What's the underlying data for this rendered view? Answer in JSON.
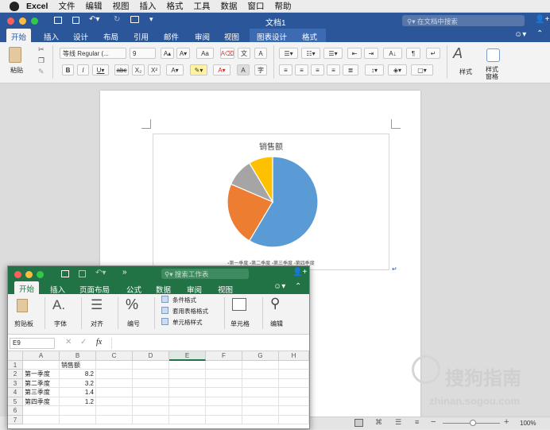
{
  "menubar": {
    "app": "Excel",
    "items": [
      "文件",
      "编辑",
      "视图",
      "插入",
      "格式",
      "工具",
      "数据",
      "窗口",
      "帮助"
    ]
  },
  "word": {
    "title": "文档1",
    "search_placeholder": "在文档中搜索",
    "tabs": [
      "开始",
      "插入",
      "设计",
      "布局",
      "引用",
      "邮件",
      "审阅",
      "视图",
      "图表设计",
      "格式"
    ],
    "font_name": "等线 Regular (...",
    "font_size": "9",
    "paste_label": "粘贴",
    "styles_label": "样式",
    "styles_pane_label": "样式\n窗格",
    "zoom": "100%"
  },
  "chart": {
    "title": "销售额",
    "legend": [
      "第一季度",
      "第二季度",
      "第三季度",
      "第四季度"
    ]
  },
  "chart_data": {
    "type": "pie",
    "title": "销售额",
    "categories": [
      "第一季度",
      "第二季度",
      "第三季度",
      "第四季度"
    ],
    "values": [
      8.2,
      3.2,
      1.4,
      1.2
    ],
    "colors": [
      "#5b9bd5",
      "#ed7d31",
      "#a5a5a5",
      "#ffc000"
    ],
    "legend_position": "bottom"
  },
  "excel": {
    "search_placeholder": "搜索工作表",
    "tabs": [
      "开始",
      "插入",
      "页面布局",
      "公式",
      "数据",
      "审阅",
      "视图"
    ],
    "groups": {
      "clipboard": "剪贴板",
      "font": "字体",
      "align": "对齐",
      "number": "编号",
      "cond_format": "条件格式",
      "table_format": "套用表格格式",
      "cell_style": "单元格样式",
      "cells": "单元格",
      "edit": "编辑"
    },
    "namebox": "E9",
    "fx": "fx",
    "cols": [
      "A",
      "B",
      "C",
      "D",
      "E",
      "F",
      "G",
      "H"
    ],
    "rows": [
      [
        "",
        "销售额"
      ],
      [
        "第一季度",
        "8.2"
      ],
      [
        "第二季度",
        "3.2"
      ],
      [
        "第三季度",
        "1.4"
      ],
      [
        "第四季度",
        "1.2"
      ],
      [
        "",
        ""
      ],
      [
        "",
        ""
      ]
    ]
  },
  "watermark": {
    "text": "搜狗指南",
    "url": "zhinan.sogou.com"
  }
}
